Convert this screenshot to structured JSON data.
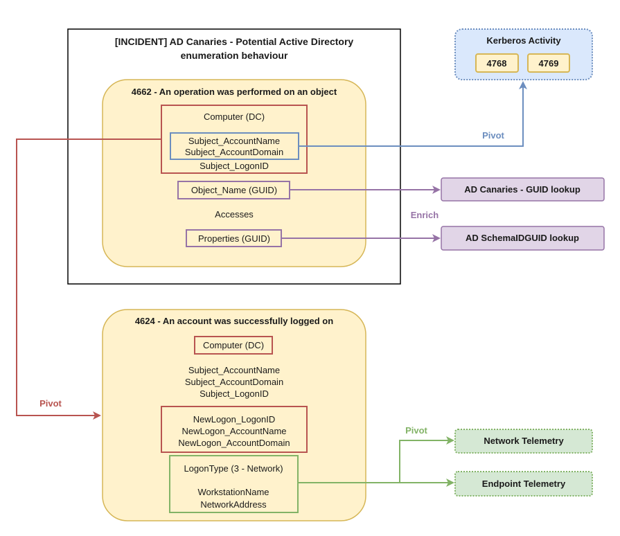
{
  "incident": {
    "title_line1": "[INCIDENT] AD Canaries - Potential Active Directory",
    "title_line2": "enumeration behaviour",
    "event_4662": {
      "header": "4662 - An operation was performed on an object",
      "computer": "Computer (DC)",
      "subject_account_name": "Subject_AccountName",
      "subject_account_domain": "Subject_AccountDomain",
      "subject_logon_id": "Subject_LogonID",
      "object_name": "Object_Name (GUID)",
      "accesses": "Accesses",
      "properties": "Properties (GUID)"
    }
  },
  "event_4624": {
    "header": "4624 - An account was successfully logged on",
    "computer": "Computer (DC)",
    "subject_account_name": "Subject_AccountName",
    "subject_account_domain": "Subject_AccountDomain",
    "subject_logon_id": "Subject_LogonID",
    "new_logon_id": "NewLogon_LogonID",
    "new_logon_account_name": "NewLogon_AccountName",
    "new_logon_account_domain": "NewLogon_AccountDomain",
    "logon_type": "LogonType (3 - Network)",
    "workstation_name": "WorkstationName",
    "network_address": "NetworkAddress"
  },
  "kerberos": {
    "title": "Kerberos Activity",
    "events": [
      "4768",
      "4769"
    ]
  },
  "enrich_targets": {
    "guid_lookup": "AD Canaries - GUID lookup",
    "schema_lookup": "AD SchemaIDGUID lookup"
  },
  "telemetry": {
    "network": "Network Telemetry",
    "endpoint": "Endpoint Telemetry"
  },
  "edge_labels": {
    "pivot_kerberos": "Pivot",
    "enrich": "Enrich",
    "pivot_logon": "Pivot",
    "pivot_telemetry": "Pivot"
  },
  "colors": {
    "red": "#b85450",
    "blue": "#6c8ebf",
    "purple": "#9673a6",
    "green": "#82b366",
    "yellow_fill": "#fff2cc",
    "yellow_stroke": "#d6b656"
  }
}
